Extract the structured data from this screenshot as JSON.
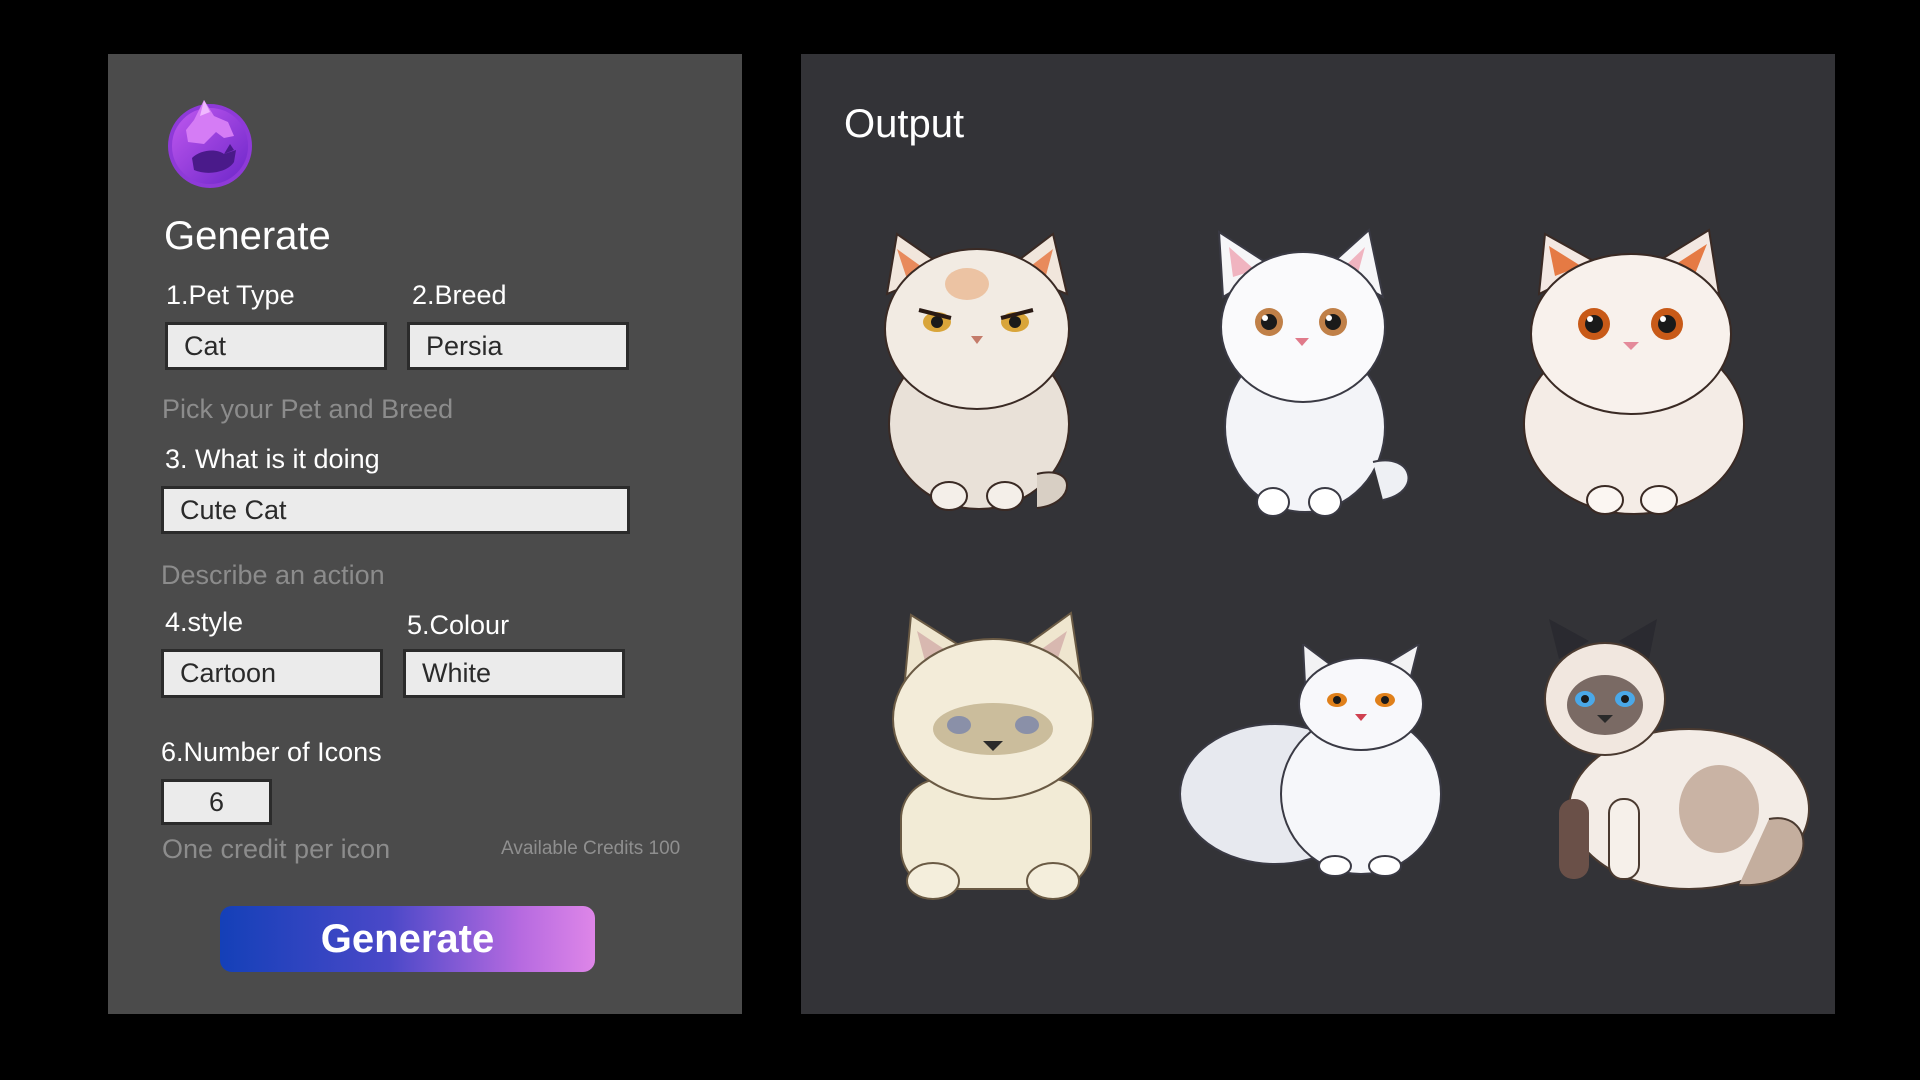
{
  "generate_panel": {
    "title": "Generate",
    "pet_type": {
      "label": "1.Pet Type",
      "value": "Cat"
    },
    "breed": {
      "label": "2.Breed",
      "value": "Persia"
    },
    "pick_hint": "Pick your Pet and Breed",
    "action": {
      "label": "3. What is it doing",
      "value": "Cute Cat"
    },
    "action_hint": "Describe an action",
    "style": {
      "label": "4.style",
      "value": "Cartoon"
    },
    "colour": {
      "label": "5.Colour",
      "value": "White"
    },
    "count": {
      "label": "6.Number of Icons",
      "value": "6"
    },
    "credit_hint": "One credit per icon",
    "available_credits": "Available Credits 100",
    "generate_button": "Generate"
  },
  "output_panel": {
    "title": "Output"
  },
  "colors": {
    "left_panel_bg": "#4b4b4b",
    "right_panel_bg": "#333337",
    "button_gradient_start": "#1440b8",
    "button_gradient_end": "#de86e8",
    "logo_purple": "#9b3fe0"
  }
}
